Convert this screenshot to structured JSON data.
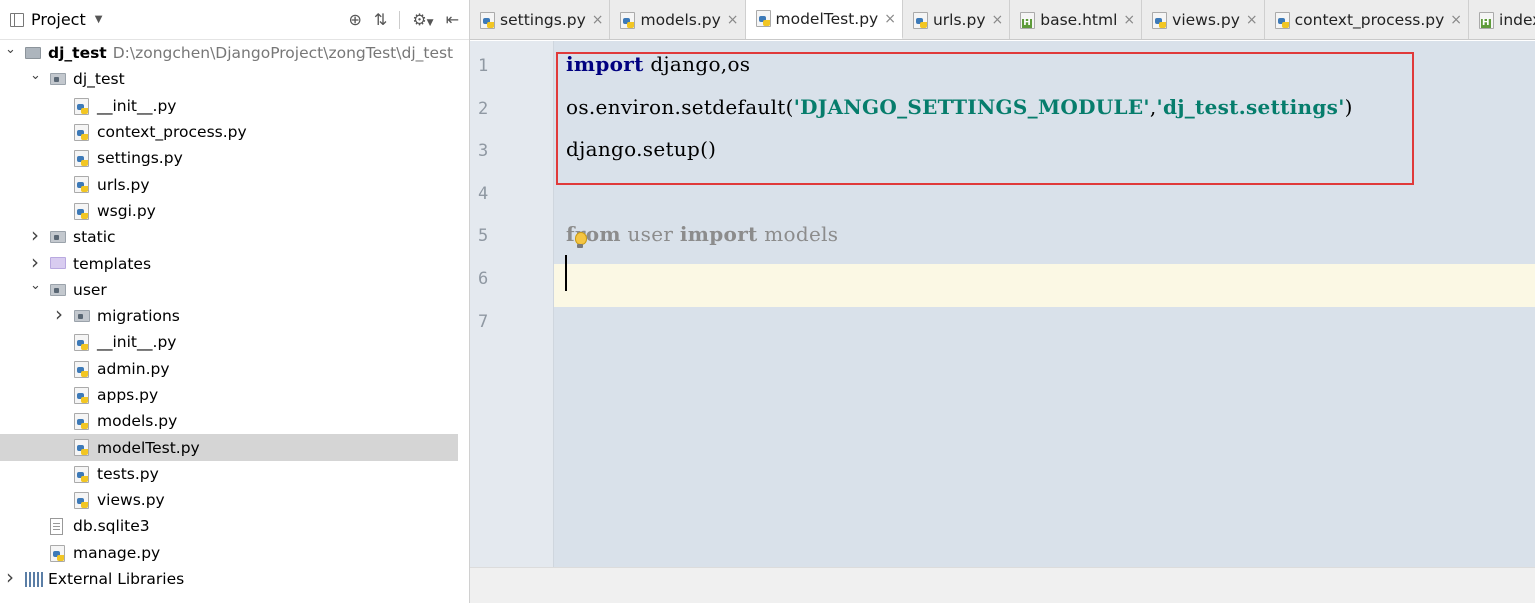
{
  "project_panel": {
    "title": "Project",
    "tools": [
      "crosshair-icon",
      "collapse-icon",
      "gear-icon",
      "hide-icon"
    ]
  },
  "tree": [
    {
      "label": "dj_test",
      "hint": "D:\\zongchen\\DjangoProject\\zongTest\\dj_test",
      "level": 0,
      "kind": "root-folder",
      "arrow": "expanded",
      "bold": true
    },
    {
      "label": "dj_test",
      "level": 1,
      "kind": "package-folder",
      "arrow": "expanded"
    },
    {
      "label": "__init__.py",
      "level": 2,
      "kind": "python"
    },
    {
      "label": "context_process.py",
      "level": 2,
      "kind": "python"
    },
    {
      "label": "settings.py",
      "level": 2,
      "kind": "python"
    },
    {
      "label": "urls.py",
      "level": 2,
      "kind": "python"
    },
    {
      "label": "wsgi.py",
      "level": 2,
      "kind": "python"
    },
    {
      "label": "static",
      "level": 1,
      "kind": "package-folder",
      "arrow": "collapsed"
    },
    {
      "label": "templates",
      "level": 1,
      "kind": "template-folder",
      "arrow": "collapsed"
    },
    {
      "label": "user",
      "level": 1,
      "kind": "package-folder",
      "arrow": "expanded"
    },
    {
      "label": "migrations",
      "level": 2,
      "kind": "package-folder",
      "arrow": "collapsed"
    },
    {
      "label": "__init__.py",
      "level": 2,
      "kind": "python"
    },
    {
      "label": "admin.py",
      "level": 2,
      "kind": "python"
    },
    {
      "label": "apps.py",
      "level": 2,
      "kind": "python"
    },
    {
      "label": "models.py",
      "level": 2,
      "kind": "python"
    },
    {
      "label": "modelTest.py",
      "level": 2,
      "kind": "python",
      "selected": true
    },
    {
      "label": "tests.py",
      "level": 2,
      "kind": "python"
    },
    {
      "label": "views.py",
      "level": 2,
      "kind": "python"
    },
    {
      "label": "db.sqlite3",
      "level": 1,
      "kind": "db"
    },
    {
      "label": "manage.py",
      "level": 1,
      "kind": "python"
    },
    {
      "label": "External Libraries",
      "level": 0,
      "kind": "library",
      "arrow": "collapsed"
    }
  ],
  "tabs": [
    {
      "label": "settings.py",
      "kind": "python"
    },
    {
      "label": "models.py",
      "kind": "python"
    },
    {
      "label": "modelTest.py",
      "kind": "python",
      "active": true
    },
    {
      "label": "urls.py",
      "kind": "python"
    },
    {
      "label": "base.html",
      "kind": "html"
    },
    {
      "label": "views.py",
      "kind": "python"
    },
    {
      "label": "context_process.py",
      "kind": "python"
    },
    {
      "label": "index",
      "kind": "html"
    }
  ],
  "editor": {
    "line_numbers": [
      "1",
      "2",
      "3",
      "4",
      "5",
      "6",
      "7"
    ],
    "current_line": 6,
    "lines": [
      [
        {
          "t": "import",
          "c": "kw"
        },
        {
          "t": " django,os",
          "c": ""
        }
      ],
      [
        {
          "t": "os.environ.setdefault(",
          "c": ""
        },
        {
          "t": "'DJANGO_SETTINGS_MODULE'",
          "c": "str"
        },
        {
          "t": ",",
          "c": ""
        },
        {
          "t": "'dj_test.settings'",
          "c": "str"
        },
        {
          "t": ")",
          "c": ""
        }
      ],
      [
        {
          "t": "django.setup()",
          "c": ""
        }
      ],
      [],
      [
        {
          "t": "from",
          "c": "kw unused"
        },
        {
          "t": " user ",
          "c": "unused"
        },
        {
          "t": "import",
          "c": "kw unused"
        },
        {
          "t": " models",
          "c": "unused"
        }
      ],
      [],
      []
    ]
  },
  "colors": {
    "accent_highlight": "#e03a3a",
    "keyword": "#000080",
    "string": "#067d6c",
    "editor_bg": "#d9e1ea",
    "current_line_bg": "#fbf8e4"
  }
}
